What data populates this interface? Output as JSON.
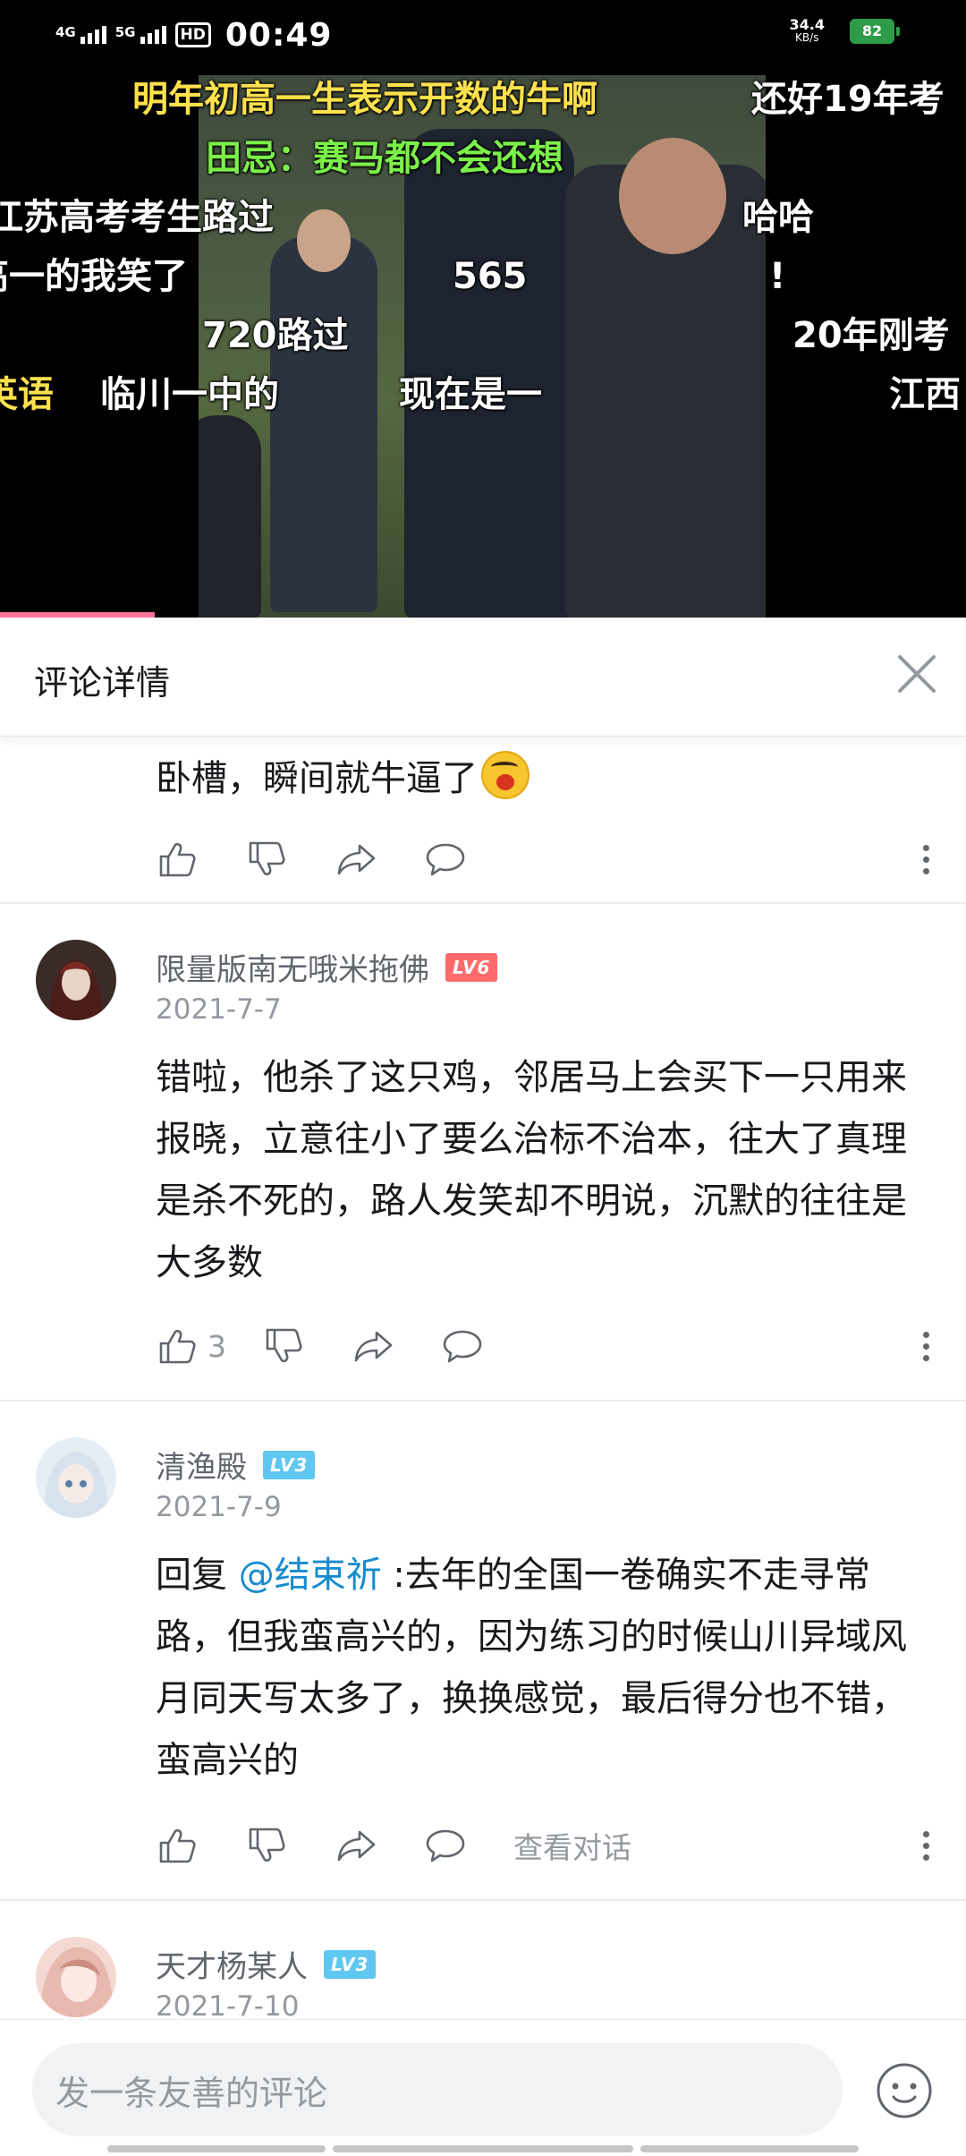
{
  "status_bar": {
    "network1": "4G",
    "network2": "5G",
    "hd": "HD",
    "time": "00:49",
    "speed_value": "34.4",
    "speed_unit": "KB/s",
    "battery": "82"
  },
  "video": {
    "danmaku": [
      {
        "text": "明年初高一生表示开数的牛啊",
        "color": "#ffe14d"
      },
      {
        "text": "还好19年考",
        "color": "#ffffff"
      },
      {
        "text": "田忌：赛马都不会还想",
        "color": "#7cf04a"
      },
      {
        "text": "江苏高考考生路过",
        "color": "#ffffff"
      },
      {
        "text": "哈哈",
        "color": "#ffffff"
      },
      {
        "text": "高一的我笑了",
        "color": "#ffffff"
      },
      {
        "text": "565",
        "color": "#ffffff"
      },
      {
        "text": "!",
        "color": "#ffffff"
      },
      {
        "text": "720路过",
        "color": "#ffffff"
      },
      {
        "text": "20年刚考",
        "color": "#ffffff"
      },
      {
        "text": "英语",
        "color": "#ffe14d"
      },
      {
        "text": "临川一中的",
        "color": "#ffffff"
      },
      {
        "text": "现在是一",
        "color": "#ffffff"
      },
      {
        "text": "江西",
        "color": "#ffffff"
      }
    ],
    "progress": 0.16,
    "progress_color": "#fb7299"
  },
  "panel": {
    "title": "评论详情"
  },
  "comments": [
    {
      "user": "",
      "level": "",
      "date": "",
      "text": "卧槽，瞬间就牛逼了",
      "emoji": "shocked-face-emoji",
      "likes": "",
      "view_conversation": ""
    },
    {
      "user": "限量版南无哦米拖佛",
      "level": "LV6",
      "level_color": "#ff6b6b",
      "date": "2021-7-7",
      "text": "错啦，他杀了这只鸡，邻居马上会买下一只用来报晓，立意往小了要么治标不治本，往大了真理是杀不死的，路人发笑却不明说，沉默的往往是大多数",
      "likes": "3",
      "view_conversation": ""
    },
    {
      "user": "清渔殿",
      "level": "LV3",
      "level_color": "#60c7f0",
      "date": "2021-7-9",
      "reply_prefix": "回复 ",
      "mention": "@结束祈",
      "text": " :去年的全国一卷确实不走寻常路，但我蛮高兴的，因为练习的时候山川异域风月同天写太多了，换换感觉，最后得分也不错，蛮高兴的",
      "likes": "",
      "view_conversation": "查看对话"
    },
    {
      "user": "天才杨某人",
      "level": "LV3",
      "level_color": "#60c7f0",
      "date": "2021-7-10"
    }
  ],
  "input": {
    "placeholder": "发一条友善的评论"
  },
  "colors": {
    "accent": "#fb7299",
    "mention": "#178bcf",
    "muted": "#9499a0"
  }
}
